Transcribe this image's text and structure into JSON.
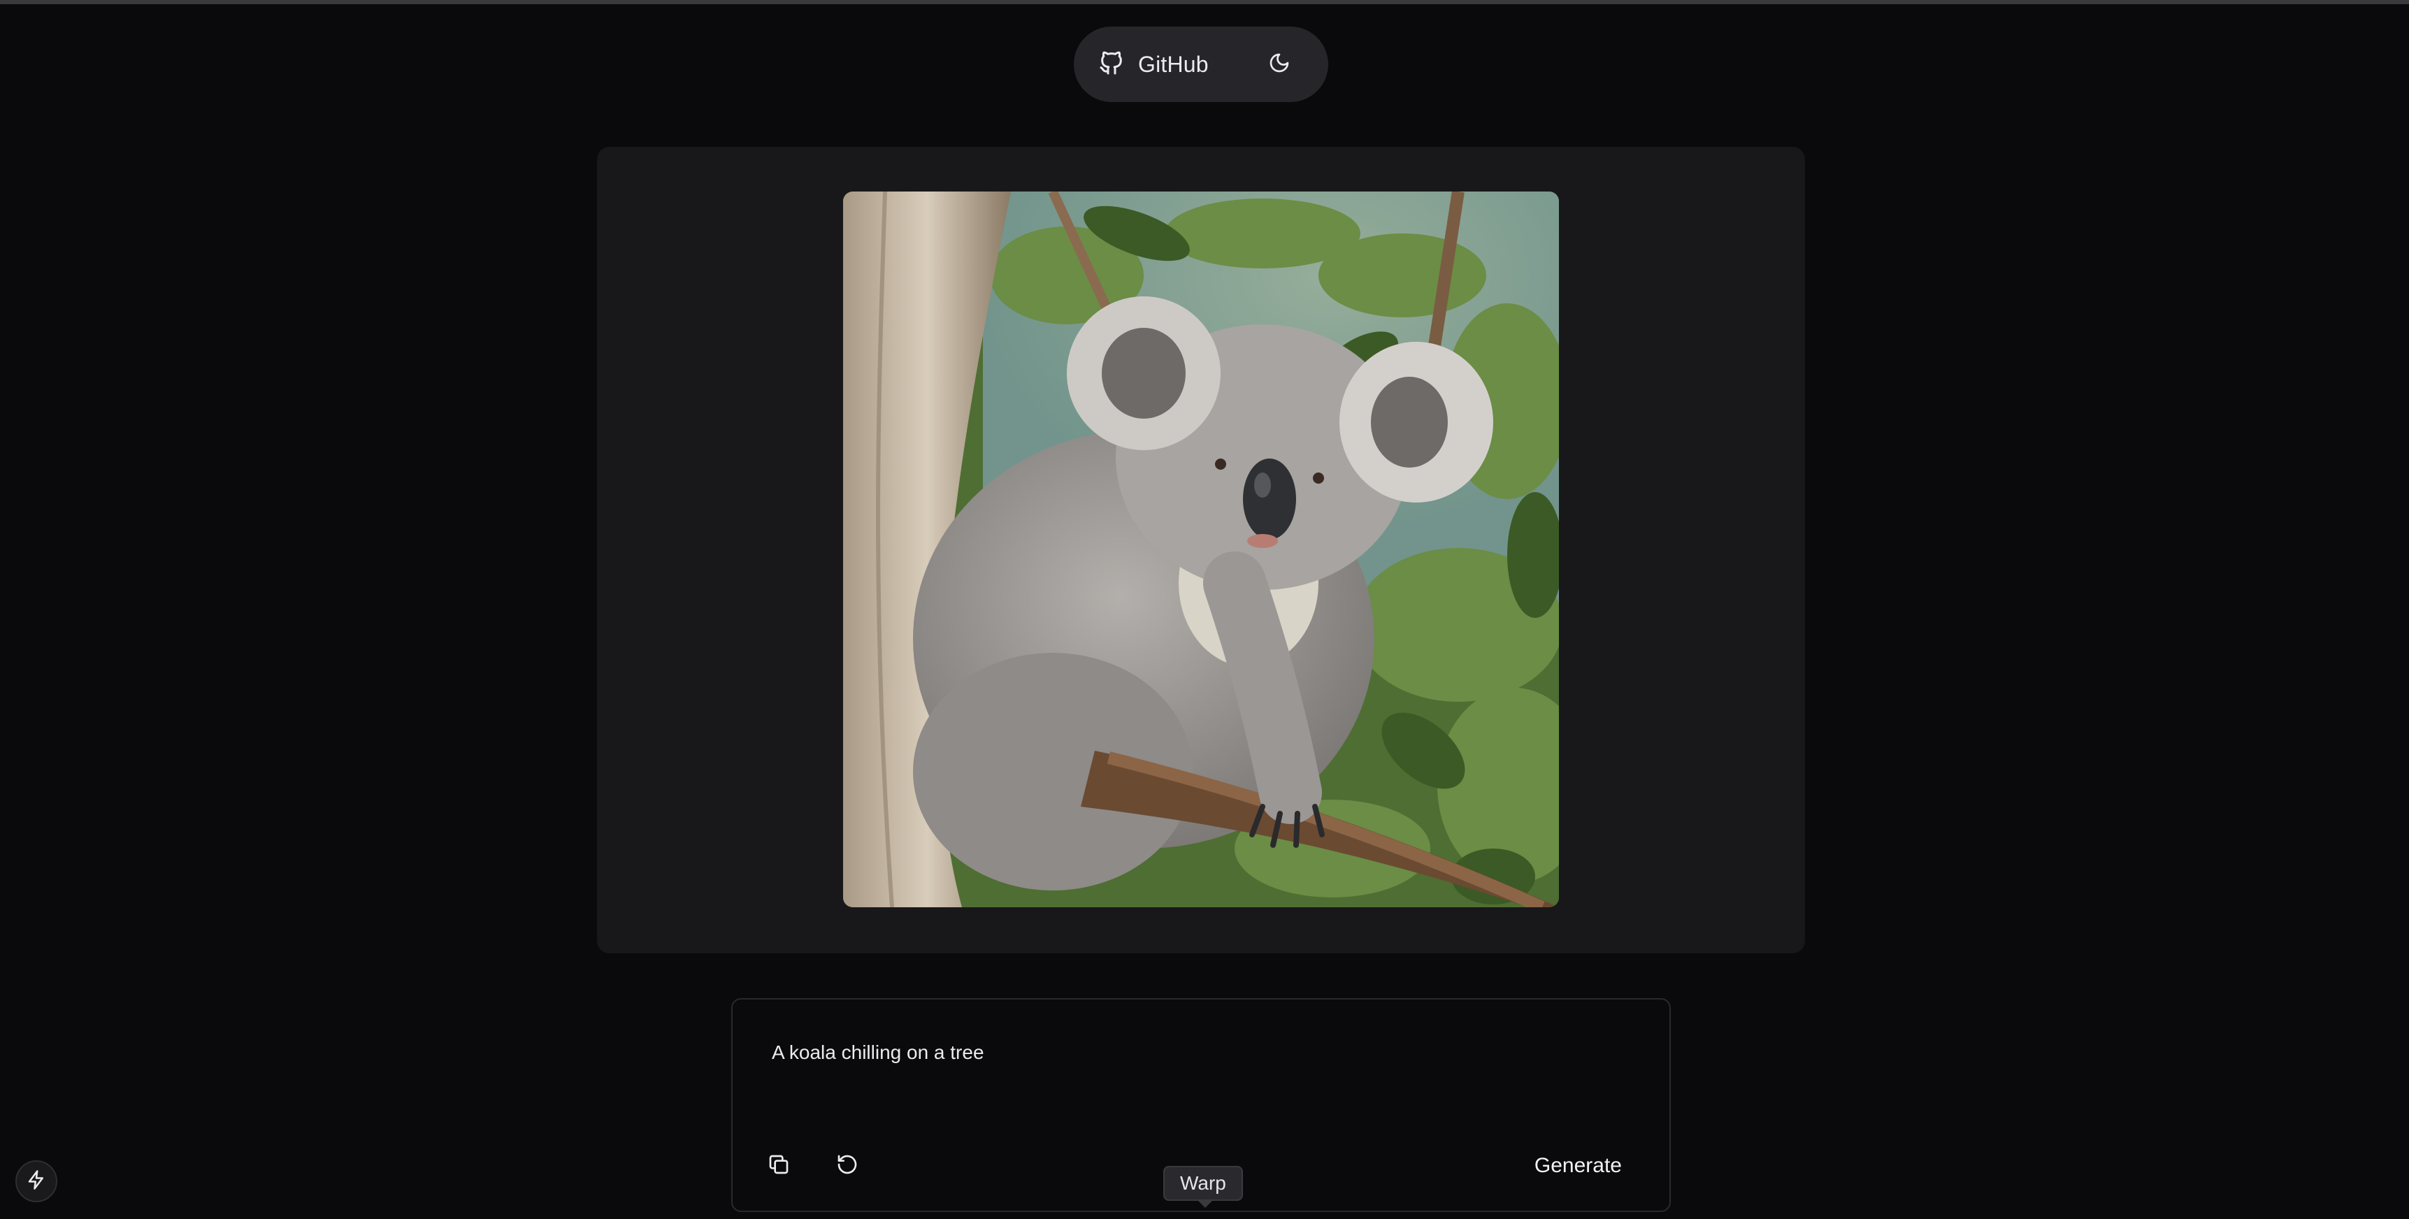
{
  "nav": {
    "github_label": "GitHub",
    "github_icon": "github-icon",
    "theme_icon": "moon-icon"
  },
  "image": {
    "subject_icon": "koala-image"
  },
  "prompt": {
    "text": "A koala chilling on a tree",
    "copy_icon": "copy-icon",
    "reset_icon": "refresh-icon",
    "generate_label": "Generate"
  },
  "tooltip": {
    "label": "Warp"
  },
  "corner": {
    "icon": "bolt-icon"
  },
  "colors": {
    "background": "#0a0a0c",
    "card": "#18181b",
    "pill": "#26262a"
  }
}
